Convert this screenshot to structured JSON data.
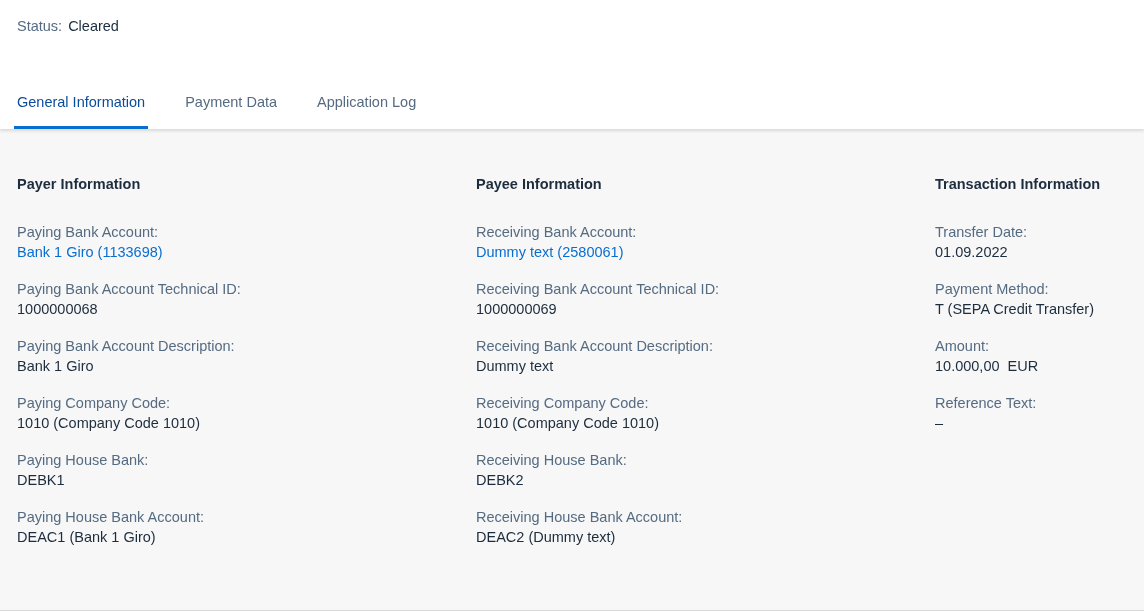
{
  "status": {
    "label": "Status:",
    "value": "Cleared"
  },
  "tabs": [
    {
      "label": "General Information",
      "selected": true
    },
    {
      "label": "Payment Data",
      "selected": false
    },
    {
      "label": "Application Log",
      "selected": false
    }
  ],
  "sections": [
    {
      "title": "Payer Information",
      "fields": [
        {
          "label": "Paying Bank Account:",
          "value": "Bank 1 Giro (1133698)",
          "kind": "link"
        },
        {
          "label": "Paying Bank Account Technical ID:",
          "value": "1000000068",
          "kind": "text"
        },
        {
          "label": "Paying Bank Account Description:",
          "value": "Bank 1 Giro",
          "kind": "text"
        },
        {
          "label": "Paying Company Code:",
          "value": "1010 (Company Code 1010)",
          "kind": "text"
        },
        {
          "label": "Paying House Bank:",
          "value": "DEBK1",
          "kind": "text"
        },
        {
          "label": "Paying House Bank Account:",
          "value": "DEAC1 (Bank 1 Giro)",
          "kind": "text"
        }
      ]
    },
    {
      "title": "Payee Information",
      "fields": [
        {
          "label": "Receiving Bank Account:",
          "value": "Dummy text (2580061)",
          "kind": "link"
        },
        {
          "label": "Receiving Bank Account Technical ID:",
          "value": "1000000069",
          "kind": "text"
        },
        {
          "label": "Receiving Bank Account Description:",
          "value": "Dummy text",
          "kind": "text"
        },
        {
          "label": "Receiving Company Code:",
          "value": "1010 (Company Code 1010)",
          "kind": "text"
        },
        {
          "label": "Receiving House Bank:",
          "value": "DEBK2",
          "kind": "text"
        },
        {
          "label": "Receiving House Bank Account:",
          "value": "DEAC2 (Dummy text)",
          "kind": "text"
        }
      ]
    },
    {
      "title": "Transaction Information",
      "fields": [
        {
          "label": "Transfer Date:",
          "value": "01.09.2022",
          "kind": "text"
        },
        {
          "label": "Payment Method:",
          "value": "T (SEPA Credit Transfer)",
          "kind": "text"
        },
        {
          "label": "Amount:",
          "value": "10.000,00  EUR",
          "kind": "text"
        },
        {
          "label": "Reference Text:",
          "value": "–",
          "kind": "text"
        }
      ]
    }
  ]
}
